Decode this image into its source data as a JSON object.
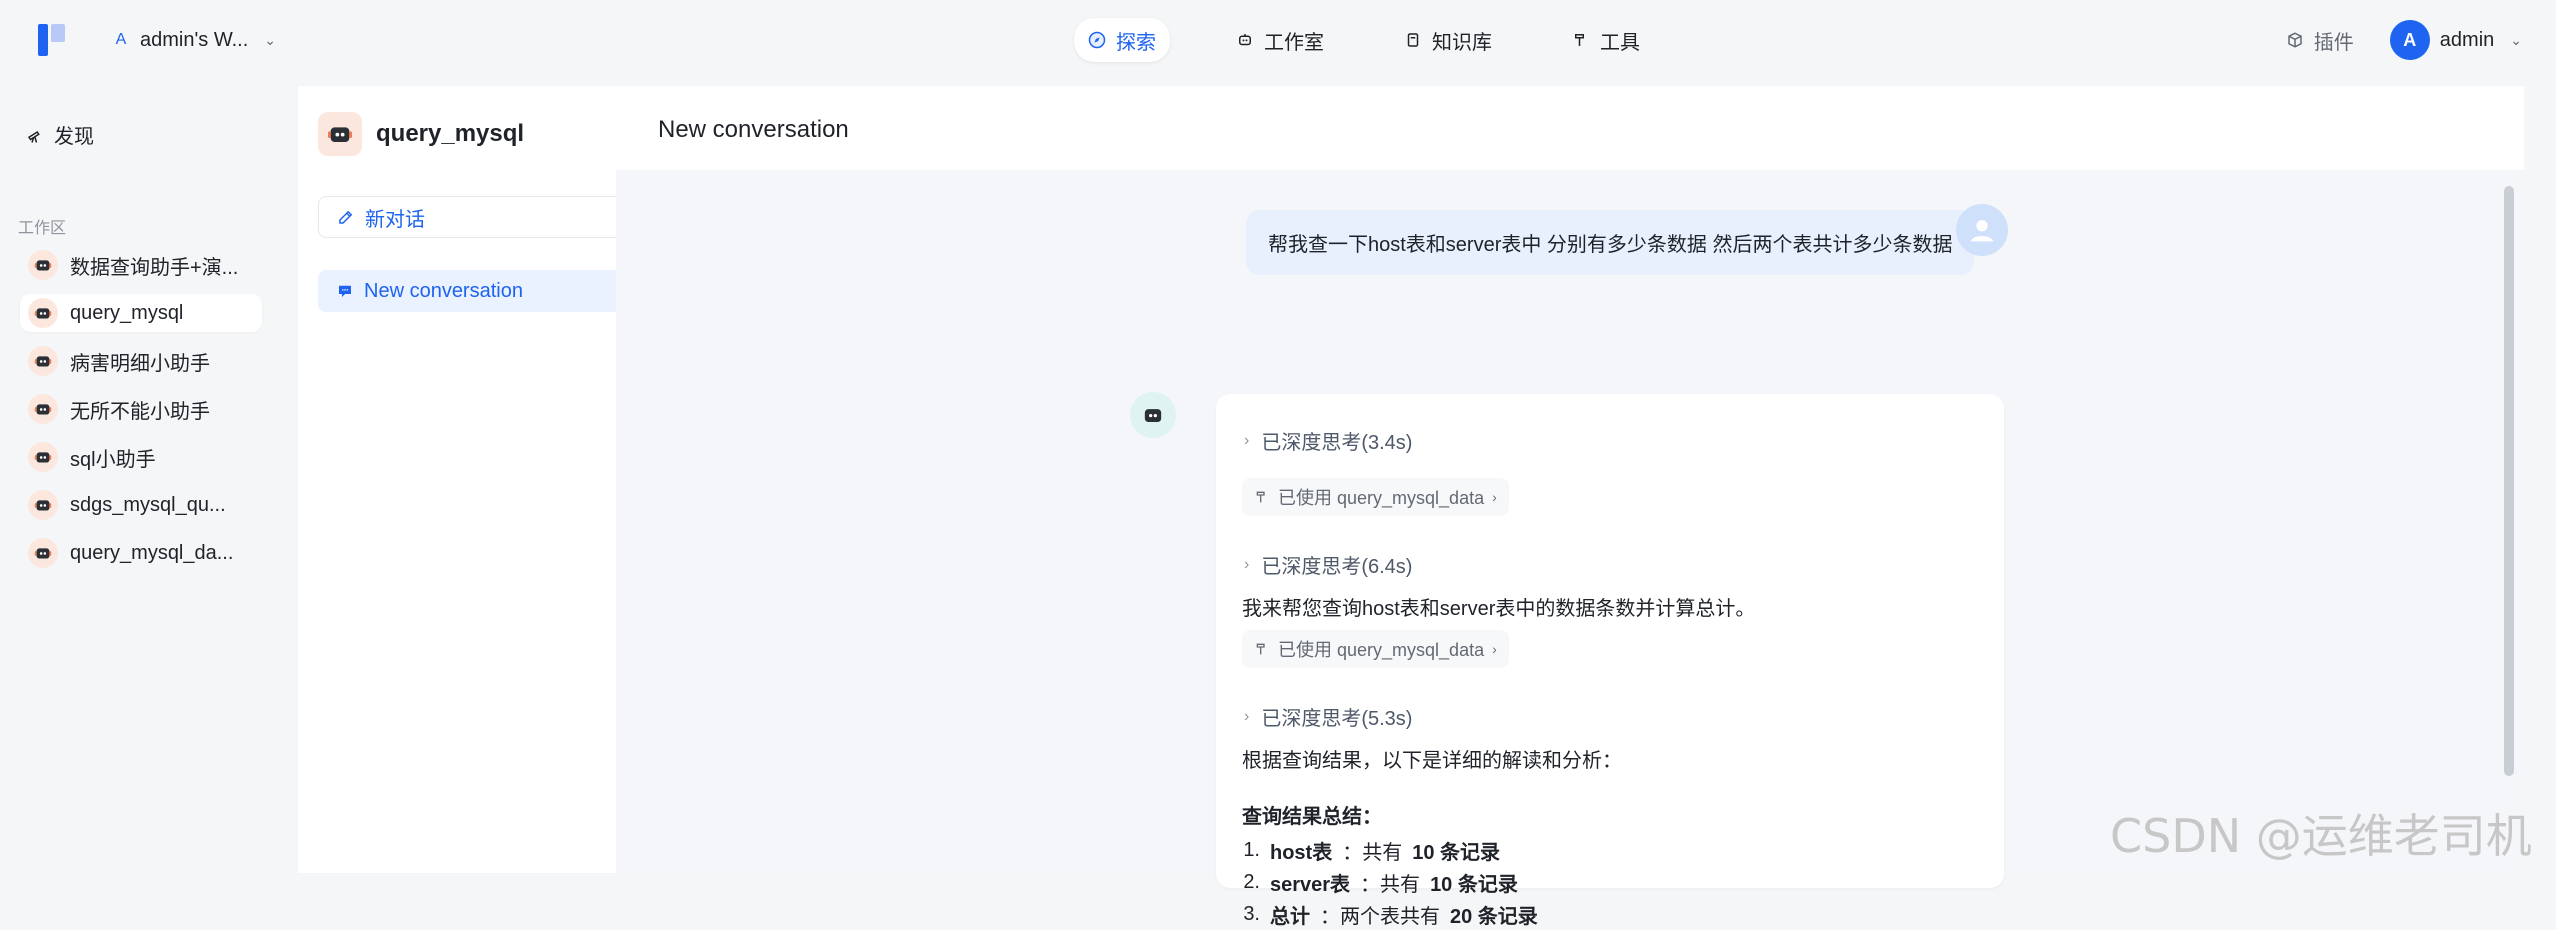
{
  "topbar": {
    "workspace_badge": "A",
    "workspace_name": "admin's W...",
    "nav": [
      {
        "label": "探索",
        "icon": "compass-icon",
        "active": true
      },
      {
        "label": "工作室",
        "icon": "bot-icon",
        "active": false
      },
      {
        "label": "知识库",
        "icon": "book-icon",
        "active": false
      },
      {
        "label": "工具",
        "icon": "hammer-icon",
        "active": false
      }
    ],
    "plugin_label": "插件",
    "avatar_letter": "A",
    "username": "admin"
  },
  "sidebar": {
    "discover": "发现",
    "section": "工作区",
    "items": [
      {
        "label": "数据查询助手+演...",
        "active": false
      },
      {
        "label": "query_mysql",
        "active": true
      },
      {
        "label": "病害明细小助手",
        "active": false
      },
      {
        "label": "无所不能小助手",
        "active": false
      },
      {
        "label": "sql小助手",
        "active": false
      },
      {
        "label": "sdgs_mysql_qu...",
        "active": false
      },
      {
        "label": "query_mysql_da...",
        "active": false
      }
    ]
  },
  "conversation_panel": {
    "agent_name": "query_mysql",
    "new_chat": "新对话",
    "items": [
      {
        "label": "New conversation"
      }
    ]
  },
  "main": {
    "title": "New conversation",
    "user_message": "帮我查一下host表和server表中 分别有多少条数据 然后两个表共计多少条数据",
    "assistant": {
      "think1": "已深度思考(3.4s)",
      "tool1": "已使用 query_mysql_data",
      "think2": "已深度思考(6.4s)",
      "text1": "我来帮您查询host表和server表中的数据条数并计算总计。",
      "tool2": "已使用 query_mysql_data",
      "think3": "已深度思考(5.3s)",
      "text2": "根据查询结果，以下是详细的解读和分析：",
      "summary_title": "查询结果总结：",
      "list": [
        {
          "n": "1.",
          "label": "host表",
          "sep": "：共有",
          "value": "10 条记录"
        },
        {
          "n": "2.",
          "label": "server表",
          "sep": "：共有",
          "value": "10 条记录"
        },
        {
          "n": "3.",
          "label": "总计",
          "sep": "：两个表共有",
          "value": "20 条记录"
        }
      ]
    }
  },
  "watermark": "CSDN @运维老司机",
  "colors": {
    "accent": "#1E64F0",
    "bubble": "#E8F0FE",
    "selected": "#EAF1FF"
  }
}
